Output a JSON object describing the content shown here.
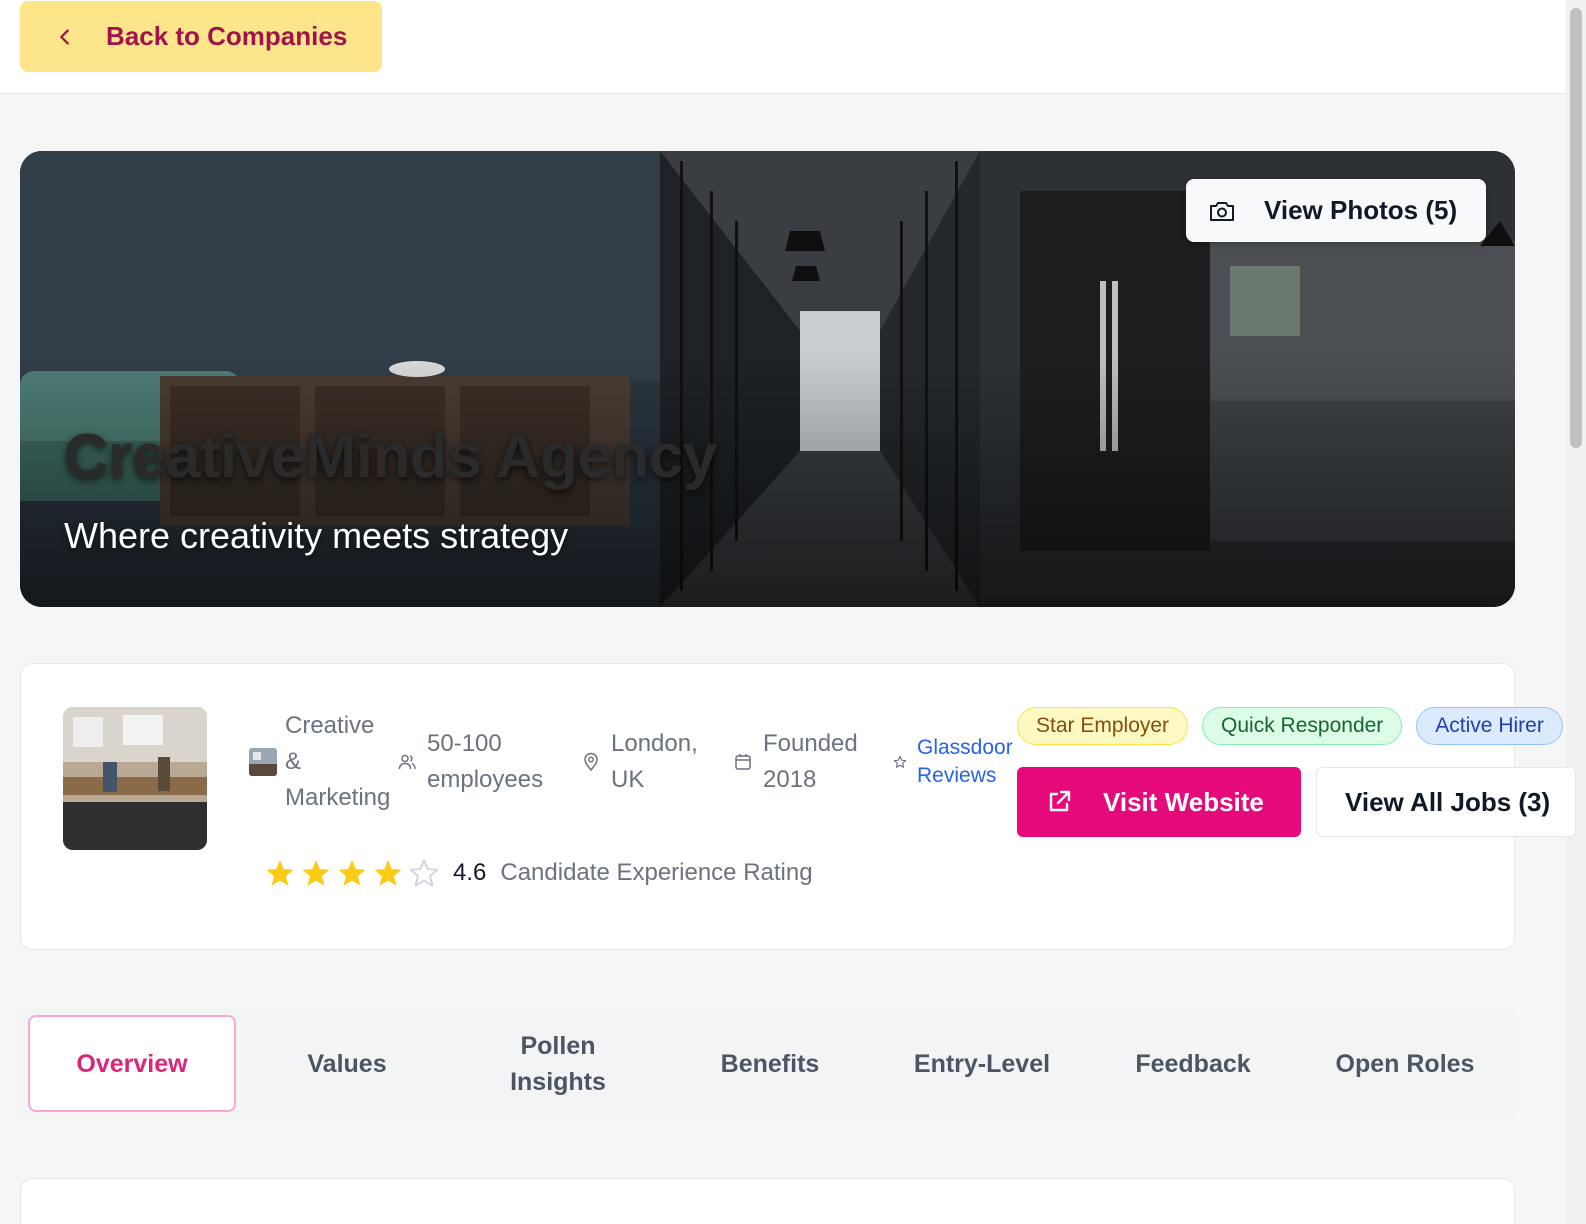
{
  "header": {
    "back_label": "Back to Companies",
    "back_icon": "chevron-left-icon"
  },
  "hero": {
    "company_name": "CreativeMinds Agency",
    "tagline": "Where creativity meets strategy",
    "view_photos_label": "View Photos (5)",
    "view_photos_icon": "camera-icon"
  },
  "company": {
    "industry": "Creative\n&\nMarketing",
    "size": "50-100\nemployees",
    "location": "London,\nUK",
    "founded": "Founded\n2018",
    "glassdoor": "Glassdoor\nReviews",
    "badges": [
      "Star Employer",
      "Quick Responder",
      "Active Hirer"
    ],
    "visit_label": "Visit Website",
    "jobs_label": "View All Jobs (3)",
    "rating_value": "4.6",
    "rating_stars": 4,
    "rating_max": 5,
    "rating_label": "Candidate Experience Rating"
  },
  "tabs": [
    "Overview",
    "Values",
    "Pollen\nInsights",
    "Benefits",
    "Entry-Level",
    "Feedback",
    "Open Roles"
  ],
  "colors": {
    "accent": "#e5097b",
    "back_button_bg": "#fde68a",
    "back_button_text": "#a0134d",
    "star": "#facc15",
    "link": "#2563eb"
  }
}
